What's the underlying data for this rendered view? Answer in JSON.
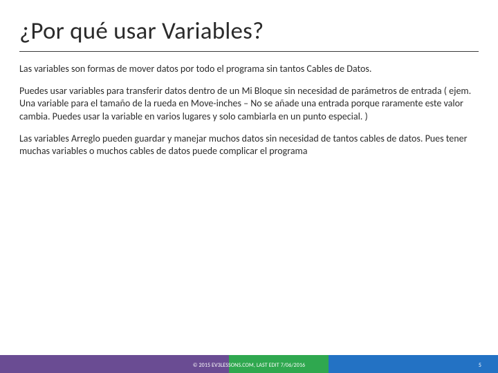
{
  "title": "¿Por qué usar Variables?",
  "paragraphs": [
    "Las variables son formas de mover datos por todo el programa sin tantos Cables de Datos.",
    "Puedes usar variables para transferir datos dentro de un Mi Bloque sin necesidad de parámetros de entrada ( ejem. Una variable para el tamaño de la rueda en Move-inches – No se añade una entrada porque raramente este valor cambia. Puedes usar la variable en varios lugares y solo cambiarla en un punto especial. )",
    "Las variables Arreglo pueden guardar y manejar muchos datos sin necesidad de tantos cables de datos. Pues tener muchas variables o muchos cables de datos puede complicar el programa"
  ],
  "footer": {
    "copyright": "© 2015 EV3LESSONS.COM, LAST EDIT 7/06/2016",
    "page": "5"
  },
  "colors": {
    "purple": "#6a4c93",
    "green": "#2fa84f",
    "blue": "#2372c4"
  }
}
